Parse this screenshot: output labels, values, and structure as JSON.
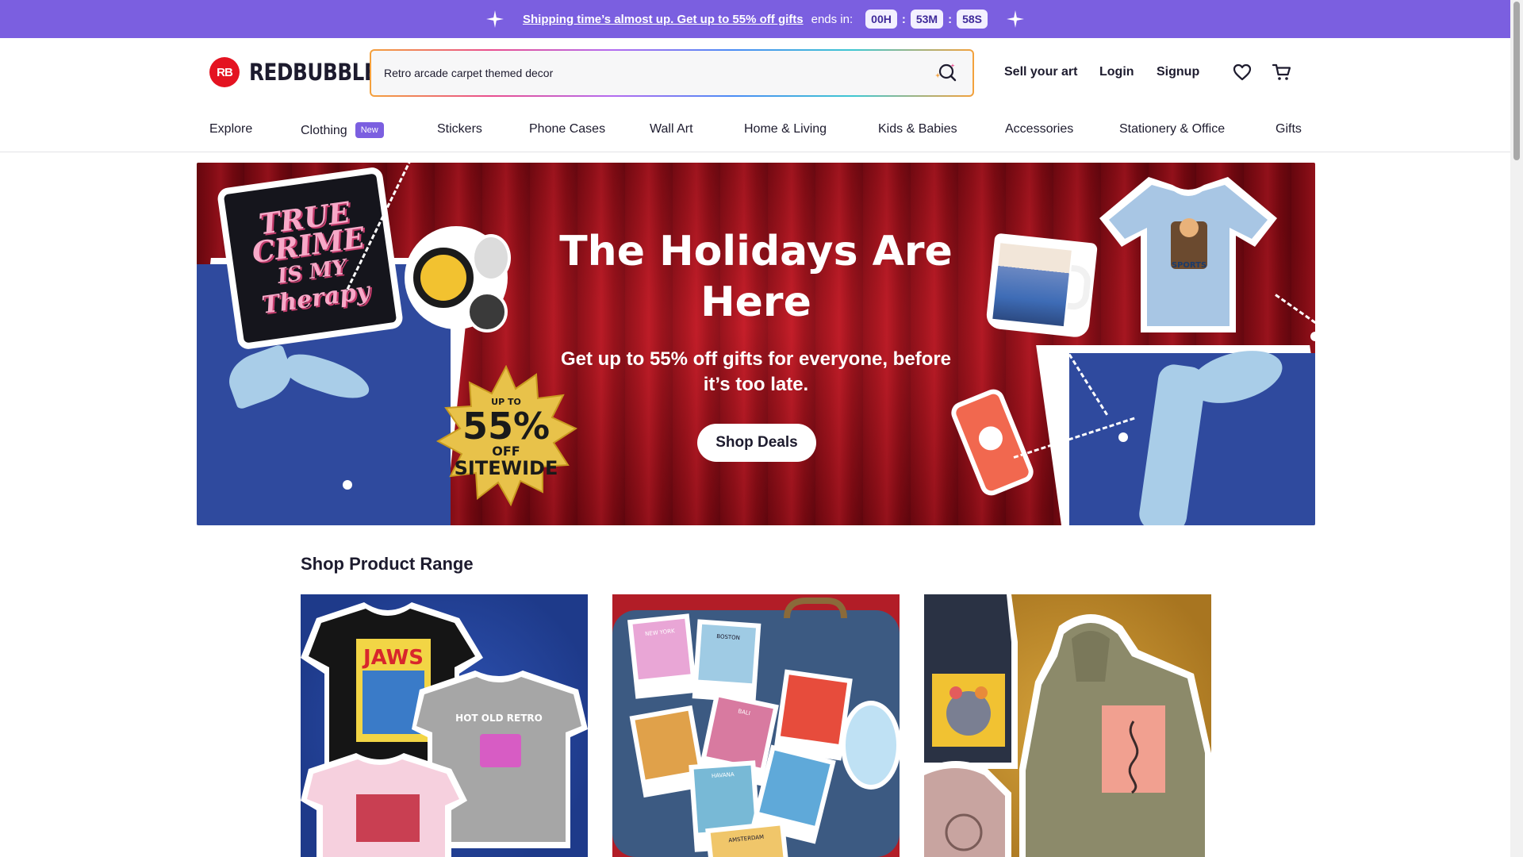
{
  "promo": {
    "link_text": "Shipping time’s almost up. Get up to 55% off gifts",
    "ends_text": "ends in:",
    "hours": "00H",
    "minutes": "53M",
    "seconds": "58S"
  },
  "header": {
    "logo_mark": "RB",
    "logo_text": "REDBUBBLE",
    "search_value": "Retro arcade carpet themed decor",
    "sell_label": "Sell your art",
    "login_label": "Login",
    "signup_label": "Signup"
  },
  "nav": {
    "items": [
      "Explore",
      "Clothing",
      "Stickers",
      "Phone Cases",
      "Wall Art",
      "Home & Living",
      "Kids & Babies",
      "Accessories",
      "Stationery & Office",
      "Gifts"
    ],
    "new_badge": "New"
  },
  "hero": {
    "title": "The Holidays Are Here",
    "subtitle": "Get up to 55% off gifts for everyone, before it’s too late.",
    "button": "Shop Deals",
    "badge_upto": "UP TO",
    "badge_percent": "55%",
    "badge_off": "OFF",
    "badge_sitewide": "SITEWIDE",
    "pillow_lines": [
      "TRUE",
      "CRIME",
      "IS MY",
      "Therapy"
    ],
    "mini_tee_text": "SPORTS"
  },
  "section": {
    "title": "Shop Product Range",
    "cards": [
      {
        "name": "clothing-card",
        "tee_text_1": "JAWS",
        "tee_text_2": "HOT OLD RETRO"
      },
      {
        "name": "stickers-card",
        "labels": [
          "NEW YORK",
          "BOSTON",
          "BALI",
          "HAVANA",
          "AMSTERDAM"
        ]
      },
      {
        "name": "hoodies-card"
      }
    ]
  },
  "colors": {
    "promo_bg": "#7b5fe0",
    "brand_red": "#e41321",
    "hero_red": "#a3121c",
    "text_dark": "#1d1b2e"
  },
  "icons": [
    "sparkle-icon",
    "search-icon",
    "heart-icon",
    "cart-icon"
  ]
}
